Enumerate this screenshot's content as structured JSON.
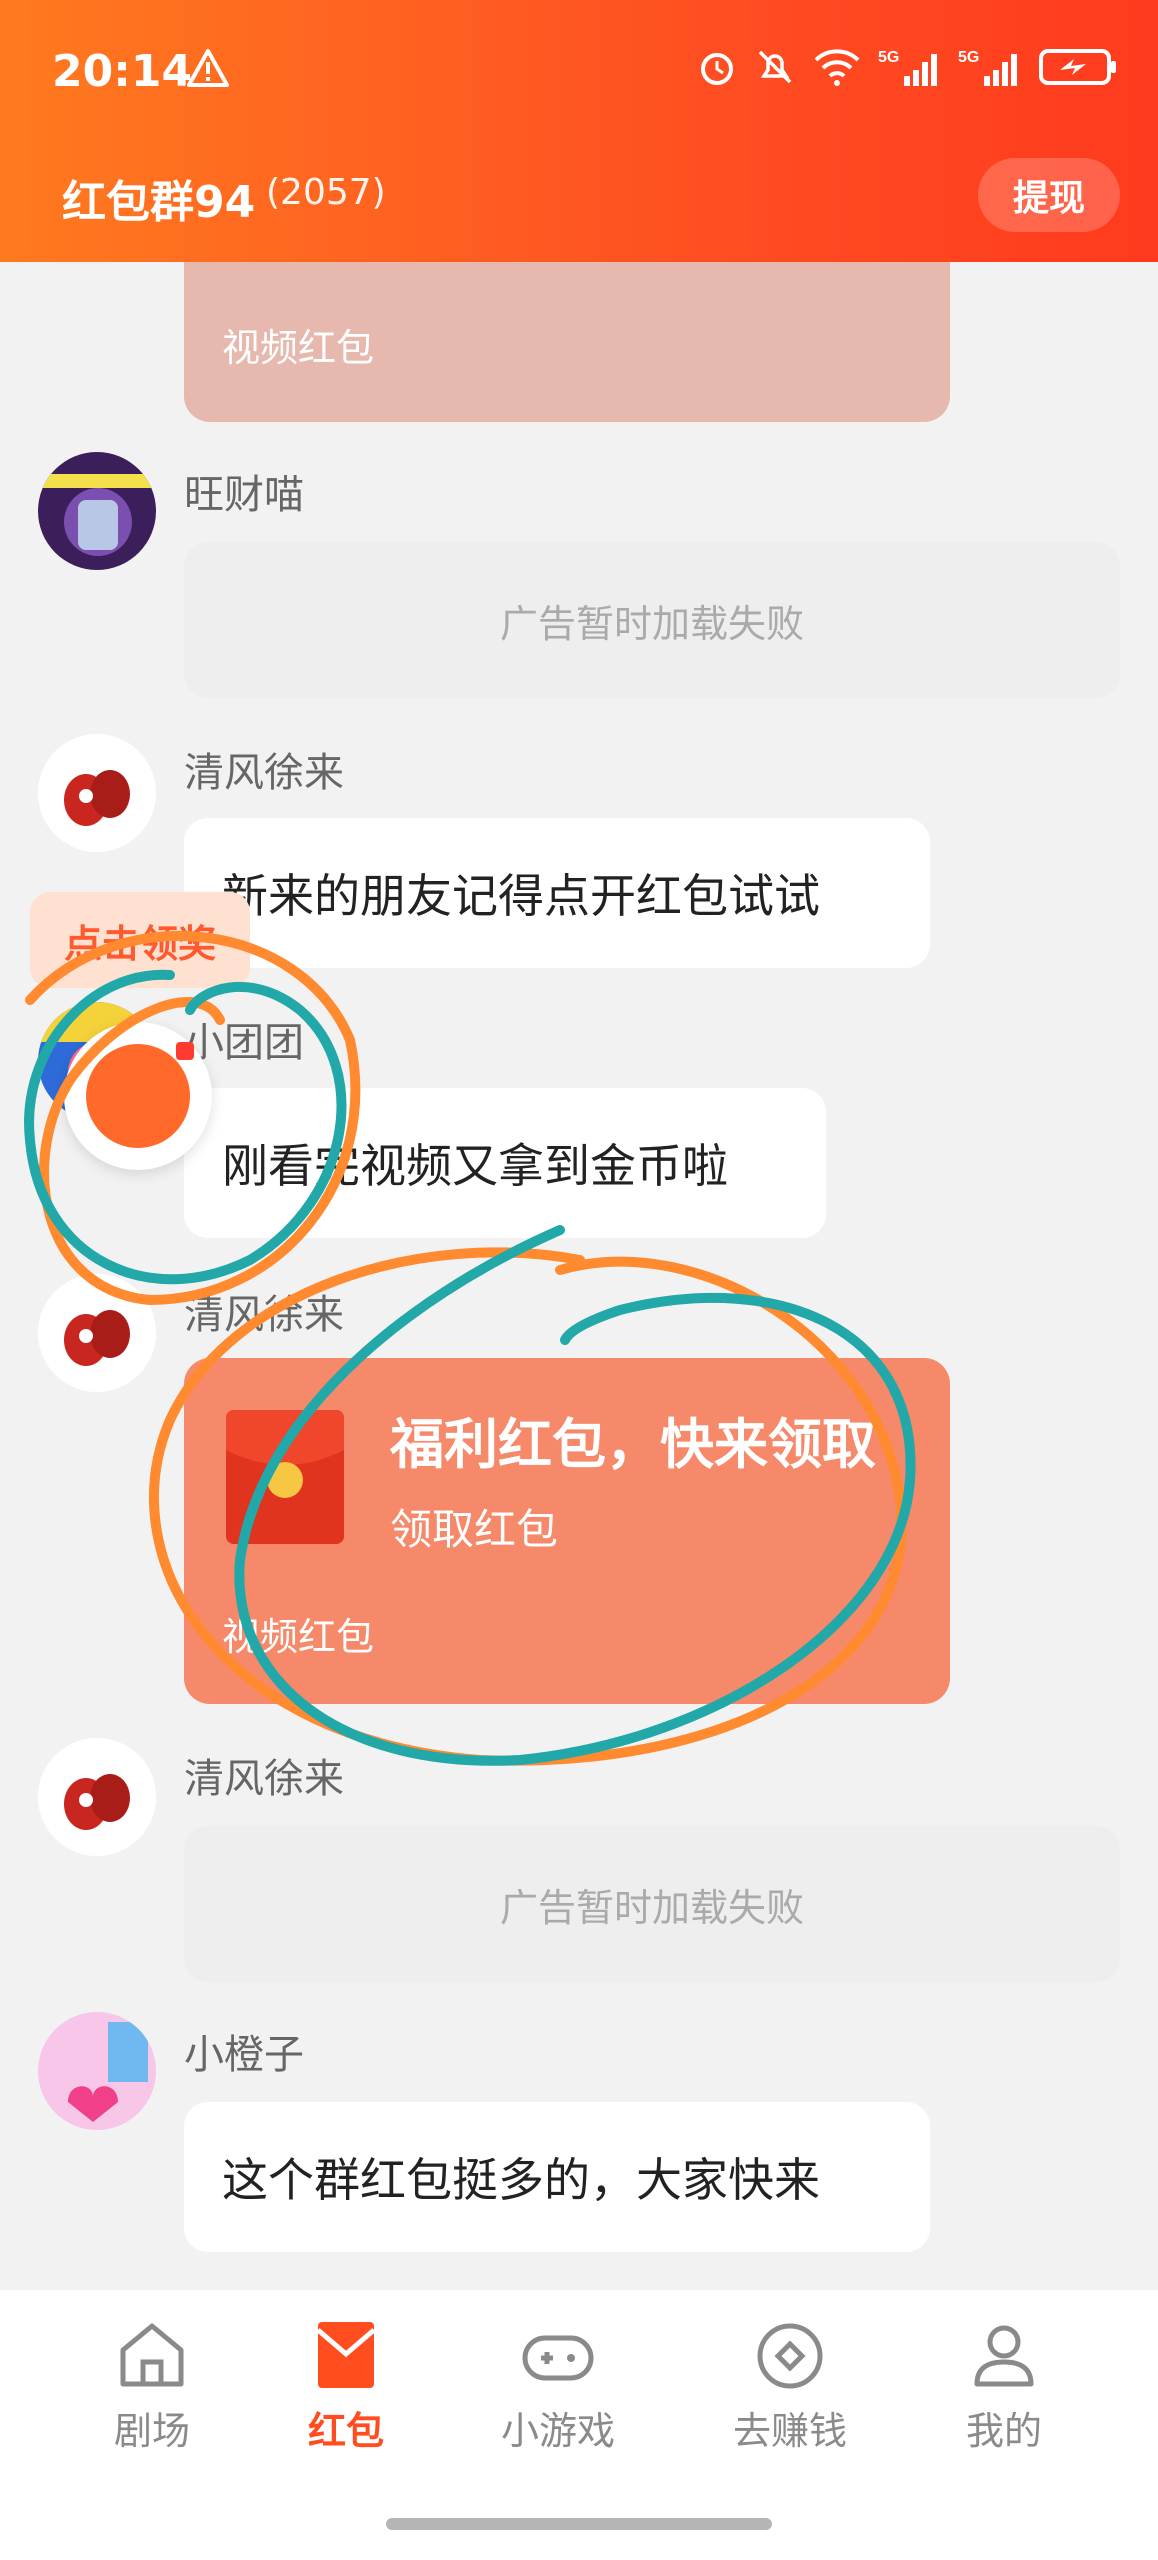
{
  "status_bar": {
    "time": "20:14"
  },
  "header": {
    "group_name": "红包群94",
    "member_count": "(2057)",
    "withdraw_label": "提现"
  },
  "messages": [
    {
      "type": "redpacket_partial",
      "footer": "视频红包"
    },
    {
      "type": "ad",
      "sender": "旺财喵",
      "text": "广告暂时加载失败"
    },
    {
      "type": "text",
      "sender": "清风徐来",
      "text": "新来的朋友记得点开红包试试"
    },
    {
      "type": "text",
      "sender": "小团团",
      "text": "刚看完视频又拿到金币啦"
    },
    {
      "type": "redpacket",
      "sender": "清风徐来",
      "title": "福利红包，快来领取",
      "subtitle": "领取红包",
      "footer": "视频红包"
    },
    {
      "type": "ad",
      "sender": "清风徐来",
      "text": "广告暂时加载失败"
    },
    {
      "type": "text",
      "sender": "小橙子",
      "text": "这个群红包挺多的，大家快来"
    }
  ],
  "floating": {
    "claim_label": "点击领奖"
  },
  "tabbar": {
    "items": [
      {
        "label": "剧场",
        "icon": "home-icon"
      },
      {
        "label": "红包",
        "icon": "red-envelope-icon",
        "active": true
      },
      {
        "label": "小游戏",
        "icon": "gamepad-icon"
      },
      {
        "label": "去赚钱",
        "icon": "coin-icon"
      },
      {
        "label": "我的",
        "icon": "person-icon"
      }
    ]
  },
  "colors": {
    "accent": "#ff4d1f",
    "header_start": "#ff7a1f",
    "header_end": "#ff3a1e",
    "redpacket": "#f5896a"
  }
}
